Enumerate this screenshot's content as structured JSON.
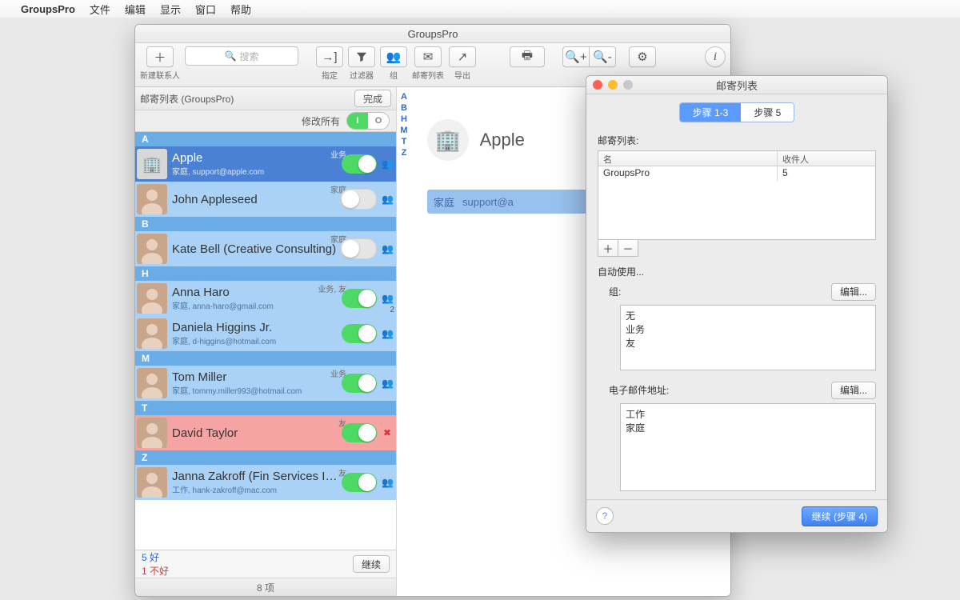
{
  "menubar": {
    "app": "GroupsPro",
    "items": [
      "文件",
      "编辑",
      "显示",
      "窗口",
      "帮助"
    ]
  },
  "window": {
    "title": "GroupsPro"
  },
  "toolbar": {
    "new_contact": "新建联系人",
    "search_placeholder": "搜索",
    "assign": "指定",
    "filter": "过滤器",
    "groups": "组",
    "mail_lists": "邮寄列表",
    "export": "导出"
  },
  "left": {
    "header_title": "邮寄列表 (GroupsPro)",
    "done": "完成",
    "modify_all": "修改所有",
    "sections": [
      "A",
      "B",
      "H",
      "M",
      "T",
      "Z"
    ],
    "status_good": "5 好",
    "status_bad": "1 不好",
    "continue": "继续",
    "count": "8 项"
  },
  "index_letters": [
    "A",
    "B",
    "H",
    "M",
    "T",
    "Z"
  ],
  "contacts": [
    {
      "section": "A",
      "name": "Apple",
      "sub": "家庭, support@apple.com",
      "tag": "业务",
      "on": true,
      "selected": true,
      "building": true
    },
    {
      "section": "A",
      "name": "John Appleseed",
      "sub": "",
      "tag": "家庭",
      "on": false
    },
    {
      "section": "B",
      "name": "Kate Bell (Creative Consulting)",
      "sub": "",
      "tag": "家庭",
      "on": false
    },
    {
      "section": "H",
      "name": "Anna Haro",
      "sub": "家庭, anna-haro@gmail.com",
      "tag": "业务, 友",
      "on": true,
      "badge": "2"
    },
    {
      "section": "H",
      "name": "Daniela Higgins Jr.",
      "sub": "家庭, d-higgins@hotmail.com",
      "tag": "",
      "on": true
    },
    {
      "section": "M",
      "name": "Tom Miller",
      "sub": "家庭, tommy.miller993@hotmail.com",
      "tag": "业务",
      "on": true
    },
    {
      "section": "T",
      "name": "David Taylor",
      "sub": "",
      "tag": "友",
      "on": true,
      "red": true,
      "err": true
    },
    {
      "section": "Z",
      "name": "Janna Zakroff (Fin Services Inc.)",
      "sub": "工作, hank-zakroff@mac.com",
      "tag": "友",
      "on": true
    }
  ],
  "detail": {
    "title": "Apple",
    "email_label": "家庭",
    "email": "support@apple.com",
    "shown_email": "support@a"
  },
  "dialog": {
    "title": "邮寄列表",
    "tab1": "步骤 1-3",
    "tab2": "步骤 5",
    "lists_label": "邮寄列表:",
    "col_name": "名",
    "col_recipients": "收件人",
    "row_name": "GroupsPro",
    "row_count": "5",
    "auto_label": "自动使用...",
    "group_label": "组:",
    "edit": "编辑...",
    "group_items": [
      "无",
      "业务",
      "友"
    ],
    "email_label": "电子邮件地址:",
    "email_items": [
      "工作",
      "家庭"
    ],
    "continue": "继续 (步骤 4)"
  }
}
